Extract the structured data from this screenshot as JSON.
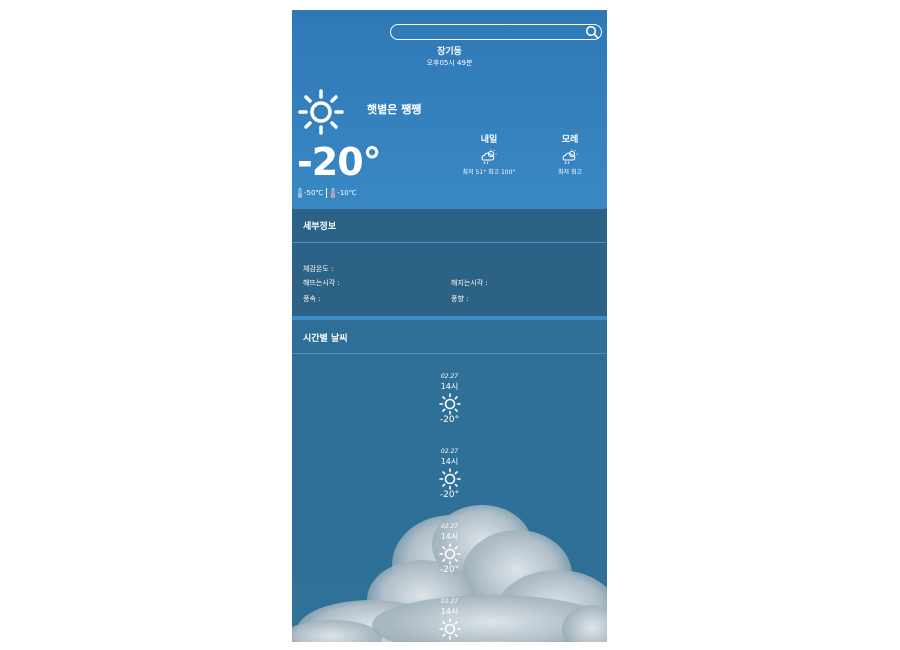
{
  "search": {
    "placeholder": ""
  },
  "location": "장기동",
  "timestamp": "오후05시 49분",
  "current": {
    "icon": "sun-icon",
    "condition": "햇볕은 쨍쨍",
    "temperature": "-20°",
    "min": "-50℃",
    "max": "-10℃"
  },
  "forecast": [
    {
      "label": "내일",
      "icon": "cloud-sun-rain-icon",
      "range": "최저 51° 최고 100°"
    },
    {
      "label": "모레",
      "icon": "cloud-sun-rain-icon",
      "range": "최저 최고"
    }
  ],
  "details": {
    "title": "세부정보",
    "feels_like": "체감온도 :",
    "sunrise": "해뜨는시각 :",
    "sunset": "해지는시각 :",
    "wind_speed": "풍속 :",
    "wind_direction": "풍향 :"
  },
  "hourly": {
    "title": "시간별 날씨",
    "items": [
      {
        "date": "02.27",
        "hour": "14시",
        "icon": "sun-icon",
        "temp": "-20°"
      },
      {
        "date": "02.27",
        "hour": "14시",
        "icon": "sun-icon",
        "temp": "-20°"
      },
      {
        "date": "02.27",
        "hour": "14시",
        "icon": "sun-icon",
        "temp": "-20°"
      },
      {
        "date": "02.27",
        "hour": "14시",
        "icon": "sun-icon",
        "temp": ""
      }
    ]
  },
  "colors": {
    "top": "#3583bf",
    "details": "#2c6285",
    "accent": "#3a8ccb",
    "sky": "#2f7197"
  }
}
